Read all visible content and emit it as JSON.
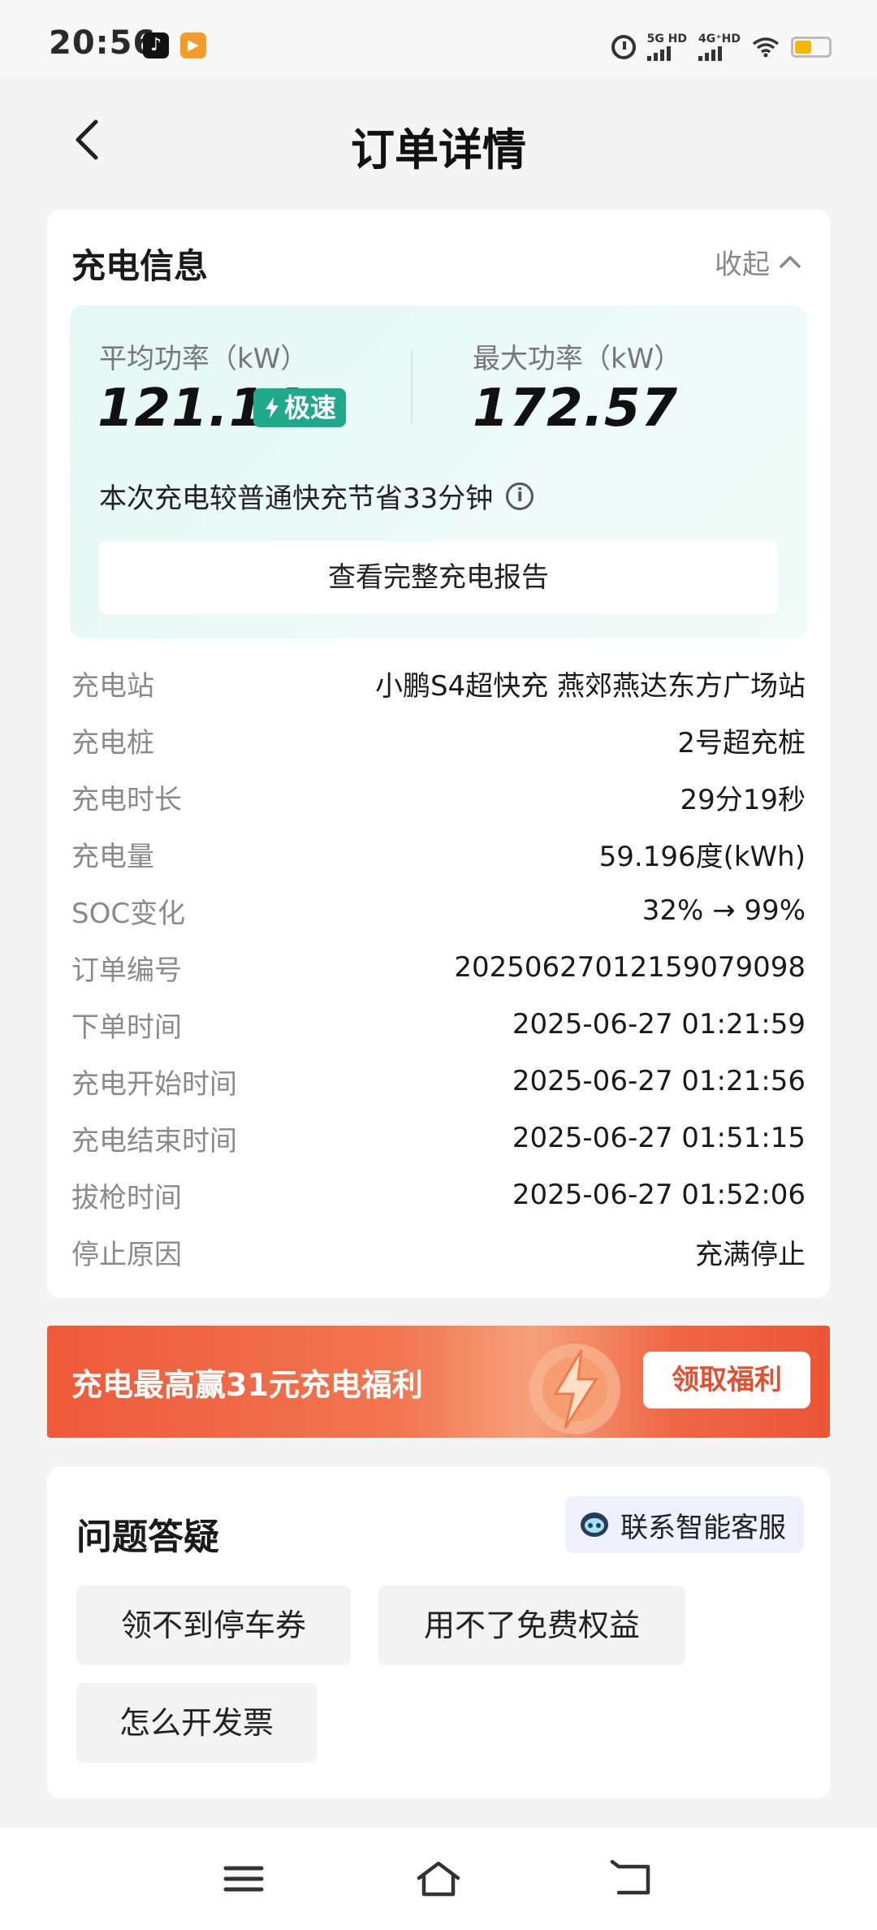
{
  "status_bar": {
    "time": "20:56",
    "app_icons": [
      "tiktok-icon",
      "video-app-icon"
    ],
    "signal_1": "5G HD",
    "signal_2": "4G⁺HD",
    "battery_level": 0.5,
    "battery_color": "#f5b800"
  },
  "nav": {
    "title": "订单详情",
    "back_icon": "chevron-left-icon"
  },
  "charge_info": {
    "heading": "充电信息",
    "collapse_label": "收起",
    "avg_power_label": "平均功率（kW）",
    "avg_power_value": "121.14",
    "fast_badge": "极速",
    "max_power_label": "最大功率（kW）",
    "max_power_value": "172.57",
    "saving_text": "本次充电较普通快充节省33分钟",
    "report_button": "查看完整充电报告",
    "rows": [
      {
        "key": "充电站",
        "value": "小鹏S4超快充 燕郊燕达东方广场站"
      },
      {
        "key": "充电桩",
        "value": "2号超充桩"
      },
      {
        "key": "充电时长",
        "value": "29分19秒"
      },
      {
        "key": "充电量",
        "value": "59.196度(kWh)"
      },
      {
        "key": "SOC变化",
        "value": "32% → 99%"
      },
      {
        "key": "订单编号",
        "value": "20250627012159079098"
      },
      {
        "key": "下单时间",
        "value": "2025-06-27 01:21:59"
      },
      {
        "key": "充电开始时间",
        "value": "2025-06-27 01:21:56"
      },
      {
        "key": "充电结束时间",
        "value": "2025-06-27 01:51:15"
      },
      {
        "key": "拔枪时间",
        "value": "2025-06-27 01:52:06"
      },
      {
        "key": "停止原因",
        "value": "充满停止"
      }
    ]
  },
  "banner": {
    "text": "充电最高赢31元充电福利",
    "button": "领取福利",
    "accent": "#ee5a3a"
  },
  "faq": {
    "title": "问题答疑",
    "contact_button": "联系智能客服",
    "chips": [
      "领不到停车券",
      "用不了免费权益",
      "怎么开发票"
    ]
  },
  "colors": {
    "brand_green": "#1fa88a",
    "page_bg": "#f4f4f4"
  }
}
